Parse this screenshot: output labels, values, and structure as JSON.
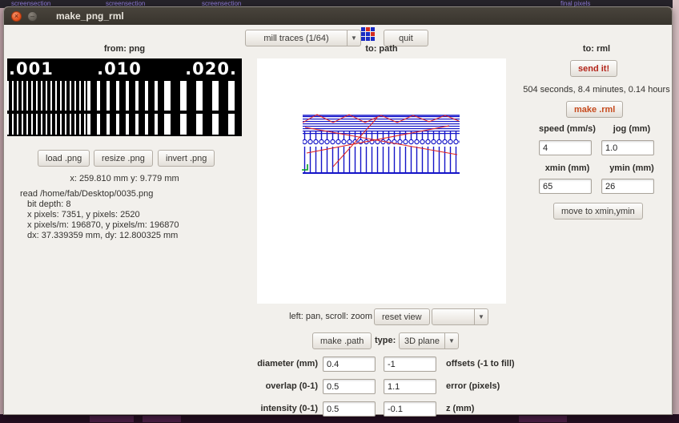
{
  "desktop": {
    "top_fragments": [
      "screensection",
      "screensection",
      "screensection",
      "final pixels"
    ]
  },
  "window": {
    "title": "make_png_rml",
    "close_glyph": "×",
    "min_glyph": "–"
  },
  "toolbar": {
    "process_value": "mill traces (1/64)",
    "quit_label": "quit"
  },
  "from_png": {
    "header": "from: png",
    "image_labels": [
      ".001",
      ".010",
      ".020."
    ],
    "load_label": "load .png",
    "resize_label": "resize .png",
    "invert_label": "invert .png",
    "size_text": "x: 259.810 mm  y: 9.779 mm",
    "info_lines": [
      "read /home/fab/Desktop/0035.png",
      "bit depth: 8",
      "x pixels: 7351, y pixels: 2520",
      "x pixels/m: 196870, y pixels/m: 196870",
      "dx: 37.339359 mm, dy: 12.800325 mm"
    ]
  },
  "to_path": {
    "header": "to: path",
    "hint_label": "left: pan, scroll: zoom",
    "reset_view_label": "reset view",
    "view_select_value": "",
    "make_path_label": "make .path",
    "type_label": "type:",
    "type_value": "3D plane",
    "rows": [
      {
        "label": "diameter (mm)",
        "value1": "0.4",
        "value2": "-1",
        "label2": "offsets (-1 to fill)"
      },
      {
        "label": "overlap (0-1)",
        "value1": "0.5",
        "value2": "1.1",
        "label2": "error (pixels)"
      },
      {
        "label": "intensity (0-1)",
        "value1": "0.5",
        "value2": "-0.1",
        "label2": "z (mm)"
      }
    ]
  },
  "to_rml": {
    "header": "to: rml",
    "send_label": "send it!",
    "time_text": "504 seconds, 8.4 minutes, 0.14 hours",
    "make_label": "make .rml",
    "speed_label": "speed (mm/s)",
    "jog_label": "jog (mm)",
    "speed_value": "4",
    "jog_value": "1.0",
    "xmin_label": "xmin (mm)",
    "ymin_label": "ymin (mm)",
    "xmin_value": "65",
    "ymin_value": "26",
    "move_label": "move to xmin,ymin"
  },
  "colors": {
    "send_accent": "#b3241a",
    "make_accent": "#c64a1d",
    "path_blue": "#1414c8",
    "path_red": "#e02020",
    "path_green": "#00a020"
  }
}
